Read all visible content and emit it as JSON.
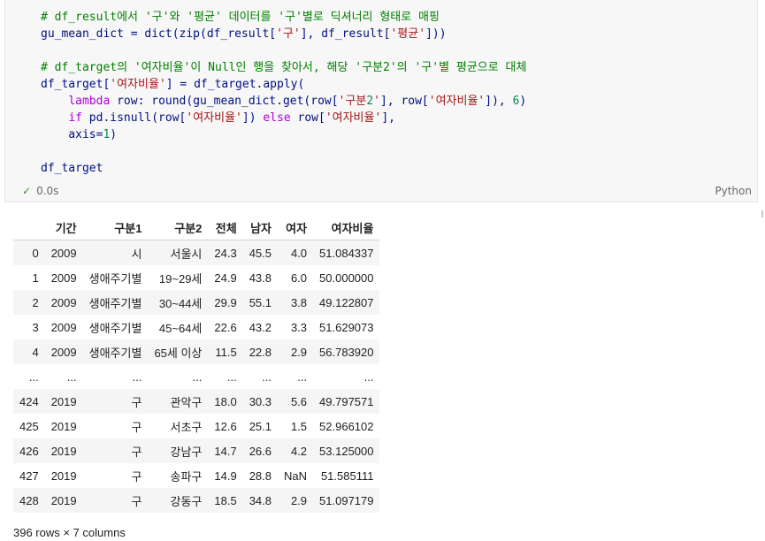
{
  "code_cell": {
    "lines": [
      "# df_result에서 '구'와 '평균' 데이터를 '구'별로 딕셔너리 형태로 매핑",
      "gu_mean_dict = dict(zip(df_result['구'], df_result['평균']))",
      "",
      "# df_target의 '여자비율'이 Null인 행을 찾아서, 해당 '구분2'의 '구'별 평균으로 대체",
      "df_target['여자비율'] = df_target.apply(",
      "    lambda row: round(gu_mean_dict.get(row['구분2'], row['여자비율']), 6)",
      "    if pd.isnull(row['여자비율']) else row['여자비율'],",
      "    axis=1)",
      "",
      "df_target"
    ],
    "status_icon": "checkmark-icon",
    "status_text": "0.0s",
    "language": "Python"
  },
  "table": {
    "columns": [
      "",
      "기간",
      "구분1",
      "구분2",
      "전체",
      "남자",
      "여자",
      "여자비율"
    ],
    "rows": [
      [
        "0",
        "2009",
        "시",
        "서울시",
        "24.3",
        "45.5",
        "4.0",
        "51.084337"
      ],
      [
        "1",
        "2009",
        "생애주기별",
        "19~29세",
        "24.9",
        "43.8",
        "6.0",
        "50.000000"
      ],
      [
        "2",
        "2009",
        "생애주기별",
        "30~44세",
        "29.9",
        "55.1",
        "3.8",
        "49.122807"
      ],
      [
        "3",
        "2009",
        "생애주기별",
        "45~64세",
        "22.6",
        "43.2",
        "3.3",
        "51.629073"
      ],
      [
        "4",
        "2009",
        "생애주기별",
        "65세 이상",
        "11.5",
        "22.8",
        "2.9",
        "56.783920"
      ],
      [
        "...",
        "...",
        "...",
        "...",
        "...",
        "...",
        "...",
        "..."
      ],
      [
        "424",
        "2019",
        "구",
        "관악구",
        "18.0",
        "30.3",
        "5.6",
        "49.797571"
      ],
      [
        "425",
        "2019",
        "구",
        "서초구",
        "12.6",
        "25.1",
        "1.5",
        "52.966102"
      ],
      [
        "426",
        "2019",
        "구",
        "강남구",
        "14.7",
        "26.6",
        "4.2",
        "53.125000"
      ],
      [
        "427",
        "2019",
        "구",
        "송파구",
        "14.9",
        "28.8",
        "NaN",
        "51.585111"
      ],
      [
        "428",
        "2019",
        "구",
        "강동구",
        "18.5",
        "34.8",
        "2.9",
        "51.097179"
      ]
    ],
    "shape_text": "396 rows × 7 columns"
  }
}
